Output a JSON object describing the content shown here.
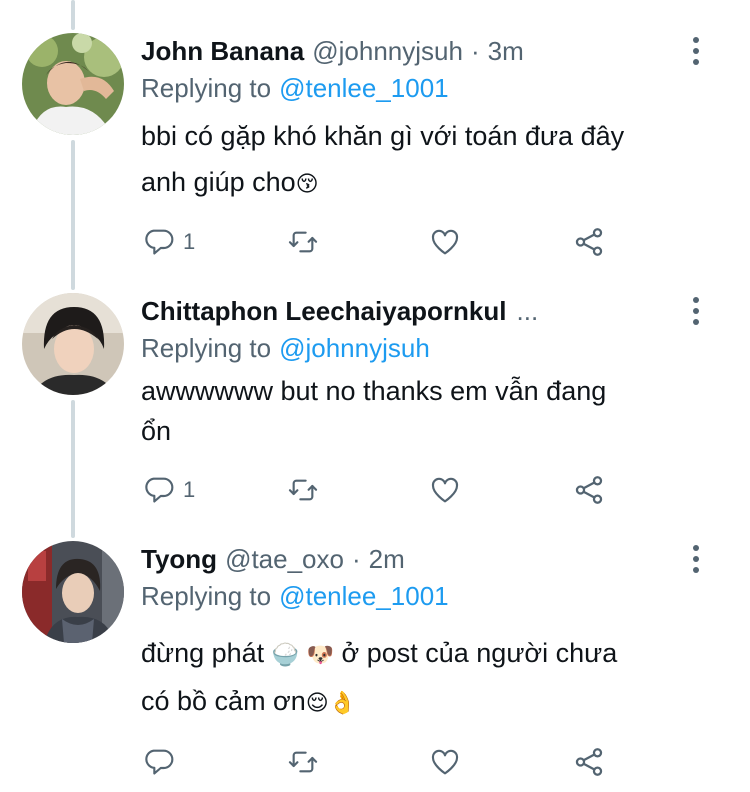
{
  "tweets": [
    {
      "name": "John Banana",
      "handle": "@johnnyjsuh",
      "dot": "·",
      "time": "3m",
      "replying_label": "Replying to",
      "replying_to": "@tenlee_1001",
      "text_lines": [
        "bbi có gặp khó khăn gì với toán đưa đây",
        "anh giúp cho"
      ],
      "emoji": "😚",
      "reply_count": "1"
    },
    {
      "name": "Chittaphon Leechaiyapornkul",
      "ellipsis": "...",
      "replying_label": "Replying to",
      "replying_to": "@johnnyjsuh",
      "text_lines": [
        "awwwwww but no thanks em vẫn đang",
        "ổn"
      ],
      "reply_count": "1"
    },
    {
      "name": "Tyong",
      "handle": "@tae_oxo",
      "dot": "·",
      "time": "2m",
      "replying_label": "Replying to",
      "replying_to": "@tenlee_1001",
      "text_line1_before": "đừng phát ",
      "emoji_rice": "🍚",
      "emoji_dog": "🐶",
      "text_line1_after": " ở post của người chưa",
      "text_line2": "có bồ cảm ơn",
      "emoji_relieved": "😌",
      "emoji_ok": "👌"
    }
  ],
  "icons": {
    "reply": "reply-icon",
    "retweet": "retweet-icon",
    "like": "heart-icon",
    "share": "share-icon",
    "more": "more-vertical-icon"
  },
  "colors": {
    "name": "#0f1419",
    "secondary": "#536471",
    "mention": "#1d9bf0",
    "thread_line": "#cfd9de"
  }
}
